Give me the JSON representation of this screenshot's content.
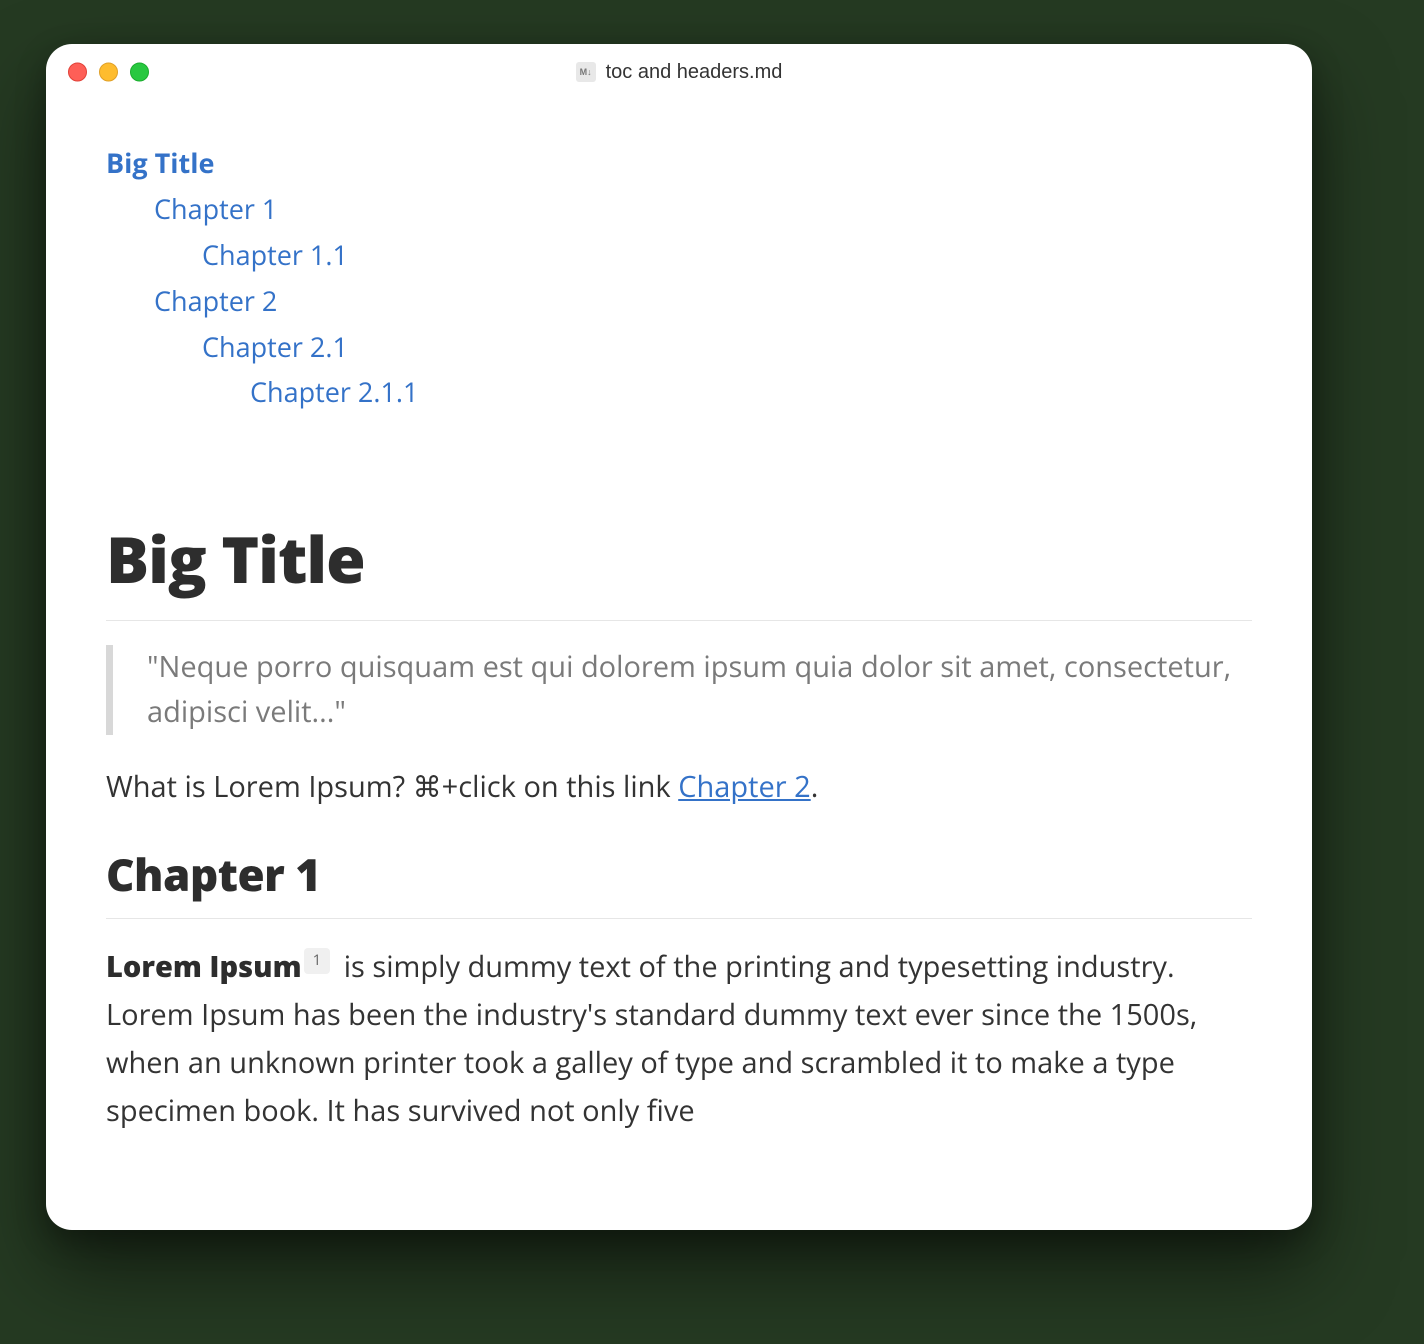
{
  "window": {
    "title": "toc and headers.md",
    "file_icon_label": "M↓"
  },
  "toc": {
    "root": "Big Title",
    "l1a": "Chapter 1",
    "l2a": "Chapter 1.1",
    "l1b": "Chapter 2",
    "l2b": "Chapter 2.1",
    "l3b": "Chapter 2.1.1"
  },
  "doc": {
    "h1": "Big Title",
    "quote": "\"Neque porro quisquam est qui dolorem ipsum quia dolor sit amet, consectetur, adipisci velit...\"",
    "intro_prefix": "What is Lorem Ipsum? ⌘+click on this link ",
    "intro_link": "Chapter 2",
    "intro_suffix": ".",
    "h2_ch1": "Chapter 1",
    "para_strong": "Lorem Ipsum",
    "footnote_marker": "1",
    "para_rest": " is simply dummy text of the printing and typesetting industry. Lorem Ipsum has been the industry's standard dummy text ever since the 1500s, when an unknown printer took a galley of type and scrambled it to make a type specimen book. It has survived not only five"
  }
}
